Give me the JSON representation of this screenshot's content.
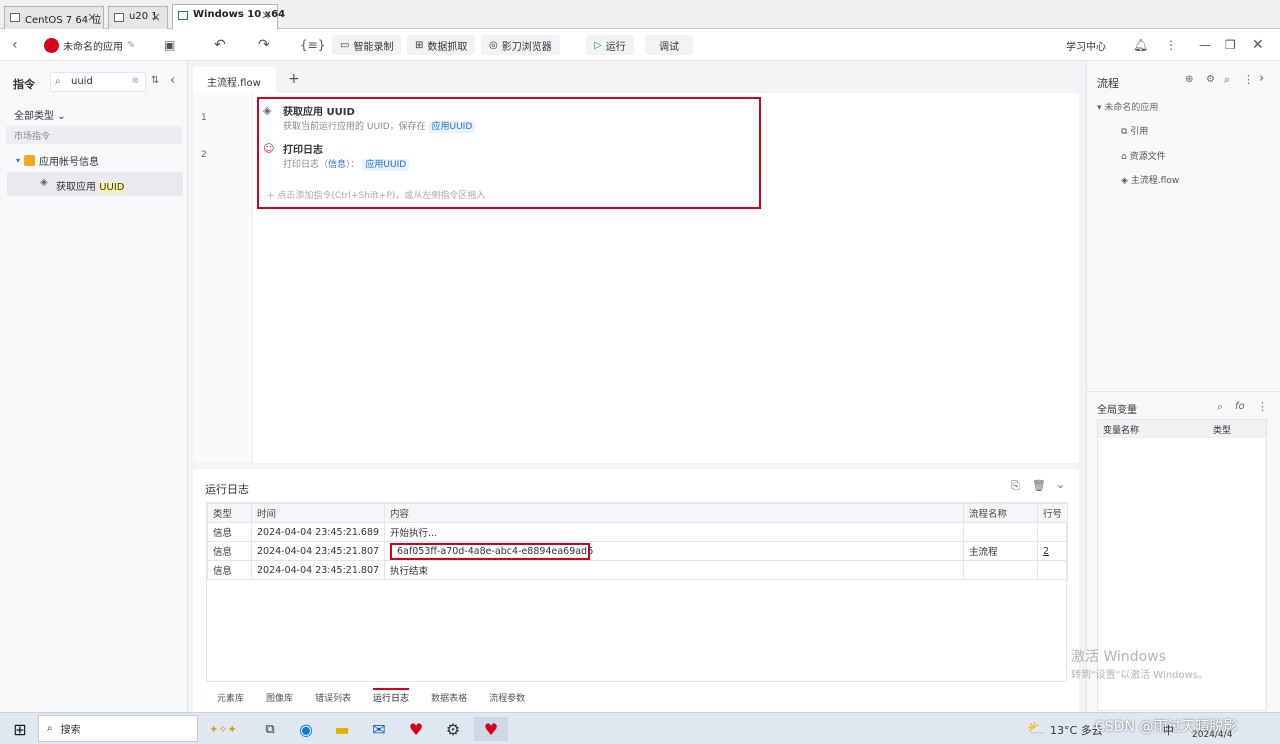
{
  "vm_tabs": [
    {
      "label": "CentOS 7 64 位"
    },
    {
      "label": "u20 1"
    },
    {
      "label": "Windows 10 x64"
    }
  ],
  "toolbar": {
    "app_name": "未命名的应用",
    "smart_record": "智能录制",
    "data_capture": "数据抓取",
    "browser": "影刀浏览器",
    "run": "运行",
    "debug": "调试",
    "learning_center": "学习中心"
  },
  "left": {
    "title": "指令",
    "search_value": "uuid",
    "all_types": "全部类型",
    "market_cmd": "市场指令",
    "group": "应用帐号信息",
    "item_prefix": "获取应用",
    "item_highlight": "UUID"
  },
  "editor": {
    "tab": "主流程.flow",
    "add_tab": "+",
    "steps": [
      {
        "line": "1",
        "title": "获取应用 UUID",
        "desc": "获取当前运行应用的 UUID，保存在",
        "var": "应用UUID"
      },
      {
        "line": "2",
        "title": "打印日志",
        "desc_pre": "打印日志（",
        "desc_link": "信息",
        "desc_post": "）：",
        "var": "应用UUID"
      }
    ],
    "add_hint": "点击添加指令(Ctrl+Shift+P)，或从左侧指令区拖入"
  },
  "right": {
    "flow_title": "流程",
    "app_node": "未命名的应用",
    "children": [
      "引用",
      "资源文件",
      "主流程.flow"
    ],
    "globals_title": "全局变量",
    "col_name": "变量名称",
    "col_type": "类型"
  },
  "log": {
    "title": "运行日志",
    "headers": [
      "类型",
      "时间",
      "内容",
      "流程名称",
      "行号"
    ],
    "rows": [
      [
        "信息",
        "2024-04-04 23:45:21.689",
        "开始执行...",
        "",
        ""
      ],
      [
        "信息",
        "2024-04-04 23:45:21.807",
        "6af053ff-a70d-4a8e-abc4-e8894ea69ad6",
        "主流程",
        "2"
      ],
      [
        "信息",
        "2024-04-04 23:45:21.807",
        "执行结束",
        "",
        ""
      ]
    ],
    "bottom_tabs": [
      "元素库",
      "图像库",
      "错误列表",
      "运行日志",
      "数据表格",
      "流程参数"
    ]
  },
  "watermark": {
    "line1": "激活 Windows",
    "line2": "转到\"设置\"以激活 Windows。"
  },
  "taskbar": {
    "search": "搜索",
    "temp": "13°C",
    "weather": "多云",
    "csdn": "CSDN @雨过天晴脱影",
    "date": "2024/4/4",
    "ime": "中"
  },
  "colors": {
    "accent": "#1e6fd9",
    "highlight_box": "#d9001b",
    "run_green": "#00b42a"
  }
}
